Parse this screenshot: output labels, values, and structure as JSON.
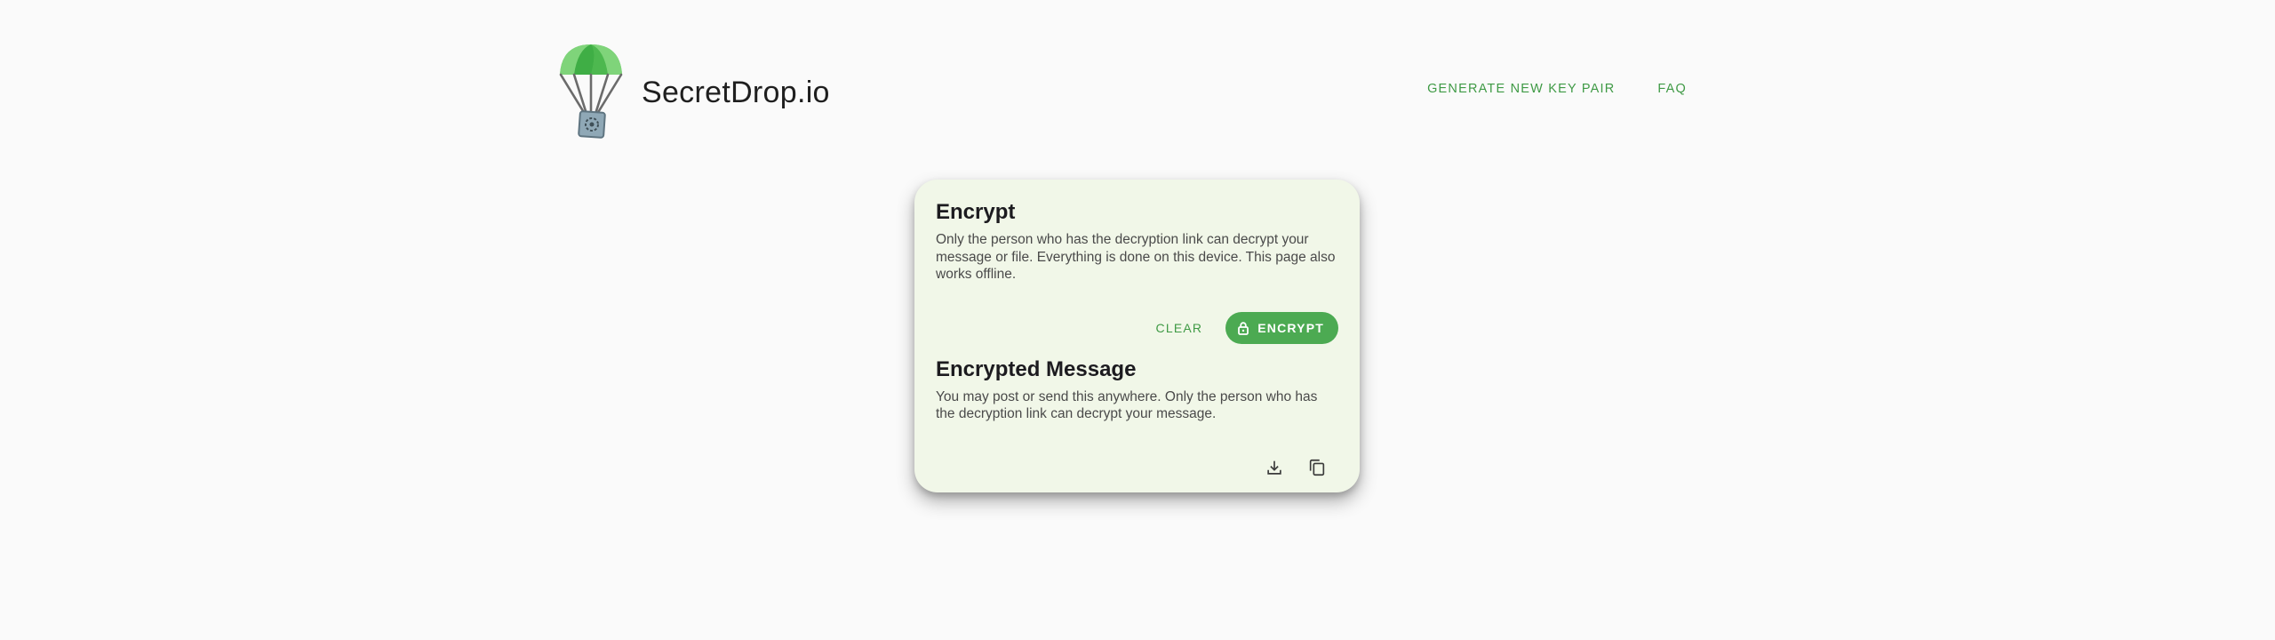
{
  "header": {
    "brand_name": "SecretDrop.io",
    "nav": {
      "generate_key_pair": "GENERATE NEW KEY PAIR",
      "faq": "FAQ"
    }
  },
  "encrypt_card": {
    "title": "Encrypt",
    "description": "Only the person who has the decryption link can decrypt your message or file. Everything is done on this device. This page also works offline.",
    "clear_label": "CLEAR",
    "encrypt_label": "ENCRYPT",
    "encrypted_title": "Encrypted Message",
    "encrypted_description": "You may post or send this anywhere. Only the person who has the decryption link can decrypt your message.",
    "icons": {
      "download": "download-icon",
      "copy": "copy-icon",
      "lock": "lock-icon",
      "logo": "parachute-logo"
    }
  },
  "colors": {
    "accent": "#4caa52",
    "link": "#3f9a45",
    "card_bg": "#f1f7e8",
    "page_bg": "#fafafa"
  }
}
